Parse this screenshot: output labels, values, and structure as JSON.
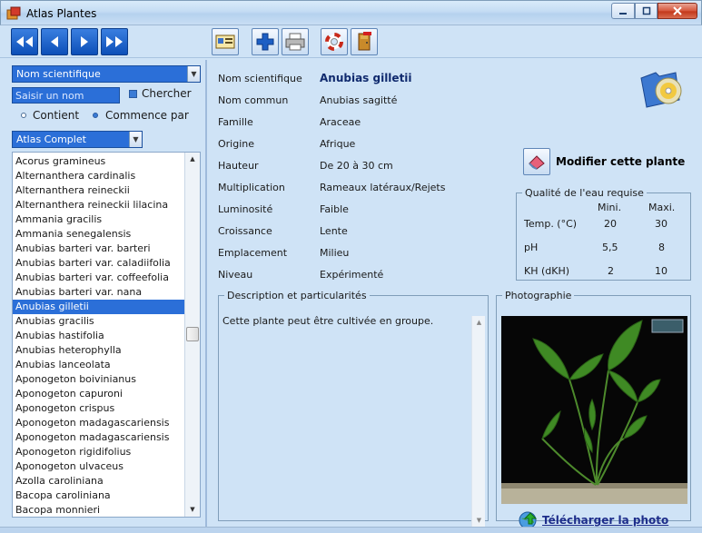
{
  "window": {
    "title": "Atlas Plantes"
  },
  "search": {
    "field_select": "Nom scientifique",
    "input_placeholder": "Saisir un nom",
    "search_label": "Chercher",
    "opt_contains": "Contient",
    "opt_starts": "Commence par",
    "atlas_select": "Atlas Complet"
  },
  "plants": [
    "Acorus gramineus",
    "Alternanthera cardinalis",
    "Alternanthera reineckii",
    "Alternanthera reineckii lilacina",
    "Ammania gracilis",
    "Ammania senegalensis",
    "Anubias barteri var. barteri",
    "Anubias barteri var. caladiifolia",
    "Anubias barteri var. coffeefolia",
    "Anubias barteri var. nana",
    "Anubias gilletii",
    "Anubias gracilis",
    "Anubias hastifolia",
    "Anubias heterophylla",
    "Anubias lanceolata",
    "Aponogeton boivinianus",
    "Aponogeton capuroni",
    "Aponogeton crispus",
    "Aponogeton madagascariensis",
    "Aponogeton madagascariensis",
    "Aponogeton rigidifolius",
    "Aponogeton ulvaceus",
    "Azolla caroliniana",
    "Bacopa caroliniana",
    "Bacopa monnieri"
  ],
  "selected_index": 10,
  "details": {
    "nom_scientifique": {
      "label": "Nom scientifique",
      "value": "Anubias gilletii"
    },
    "nom_commun": {
      "label": "Nom commun",
      "value": "Anubias sagitté"
    },
    "famille": {
      "label": "Famille",
      "value": "Araceae"
    },
    "origine": {
      "label": "Origine",
      "value": "Afrique"
    },
    "hauteur": {
      "label": "Hauteur",
      "value": "De 20 à 30 cm"
    },
    "multiplication": {
      "label": "Multiplication",
      "value": "Rameaux latéraux/Rejets"
    },
    "luminosite": {
      "label": "Luminosité",
      "value": "Faible"
    },
    "croissance": {
      "label": "Croissance",
      "value": "Lente"
    },
    "emplacement": {
      "label": "Emplacement",
      "value": "Milieu"
    },
    "niveau": {
      "label": "Niveau",
      "value": "Expérimenté"
    }
  },
  "edit_button": "Modifier cette plante",
  "water": {
    "title": "Qualité de l'eau requise",
    "col_min": "Mini.",
    "col_max": "Maxi.",
    "temp": {
      "label": "Temp. (°C)",
      "min": "20",
      "max": "30"
    },
    "ph": {
      "label": "pH",
      "min": "5,5",
      "max": "8"
    },
    "kh": {
      "label": "KH (dKH)",
      "min": "2",
      "max": "10"
    }
  },
  "description": {
    "title": "Description et particularités",
    "text": "Cette plante peut être cultivée en groupe."
  },
  "photo": {
    "title": "Photographie",
    "download_link": "Télécharger la photo"
  },
  "colors": {
    "accent": "#2b6fd8",
    "panel": "#cfe3f6",
    "value_text": "#102a6e"
  }
}
